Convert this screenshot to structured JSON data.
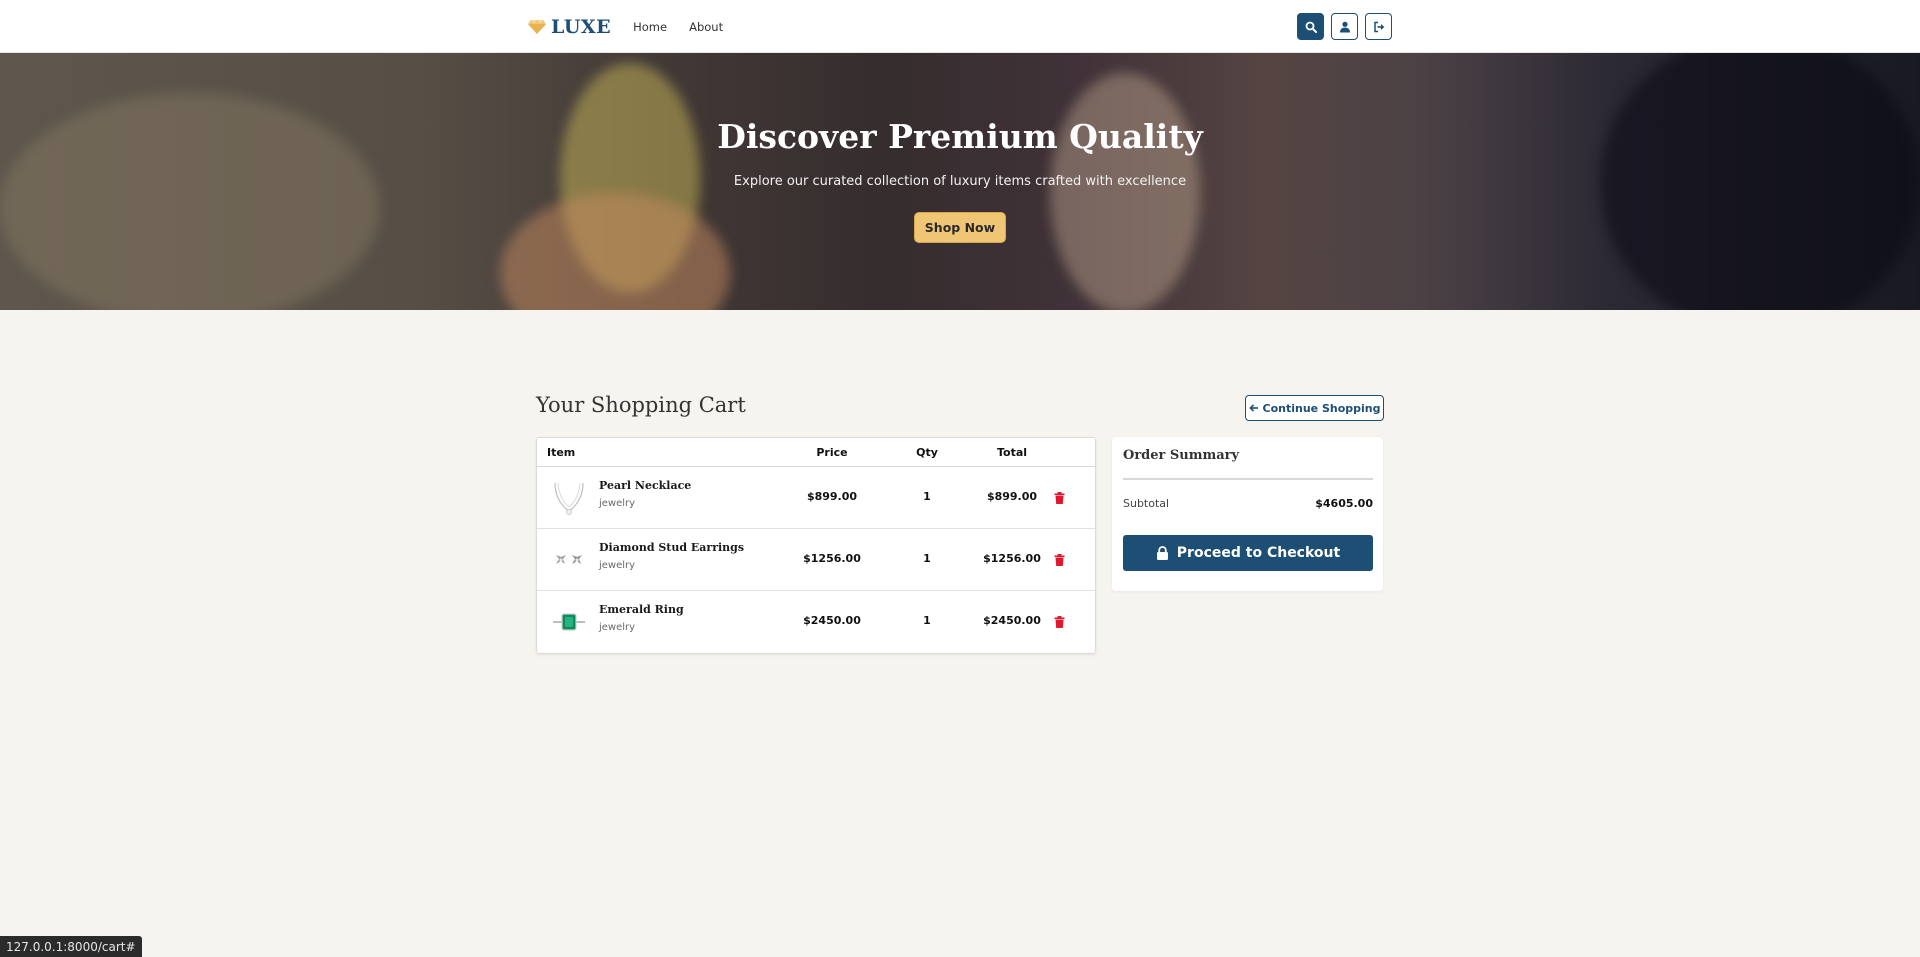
{
  "navbar": {
    "brand": "LUXE",
    "links": [
      "Home",
      "About"
    ],
    "actions": [
      "search-icon",
      "user-icon",
      "logout-icon"
    ]
  },
  "hero": {
    "title": "Discover Premium Quality",
    "subtitle": "Explore our curated collection of luxury items crafted with excellence",
    "cta": "Shop Now"
  },
  "cart": {
    "title": "Your Shopping Cart",
    "continue_label": "Continue Shopping",
    "columns": [
      "Item",
      "Price",
      "Qty",
      "Total"
    ],
    "items": [
      {
        "name": "Pearl Necklace",
        "category": "jewelry",
        "price": "$899.00",
        "qty": "1",
        "total": "$899.00",
        "icon": "necklace-thumb"
      },
      {
        "name": "Diamond Stud Earrings",
        "category": "jewelry",
        "price": "$1256.00",
        "qty": "1",
        "total": "$1256.00",
        "icon": "earrings-thumb"
      },
      {
        "name": "Emerald Ring",
        "category": "jewelry",
        "price": "$2450.00",
        "qty": "1",
        "total": "$2450.00",
        "icon": "ring-thumb"
      }
    ]
  },
  "summary": {
    "title": "Order Summary",
    "subtotal_label": "Subtotal",
    "subtotal_value": "$4605.00",
    "checkout_label": "Proceed to Checkout"
  },
  "status_url": "127.0.0.1:8000/cart#",
  "colors": {
    "primary": "#1d4e74",
    "accent": "#f0c674",
    "danger": "#e0182d",
    "background": "#f6f4ef"
  }
}
